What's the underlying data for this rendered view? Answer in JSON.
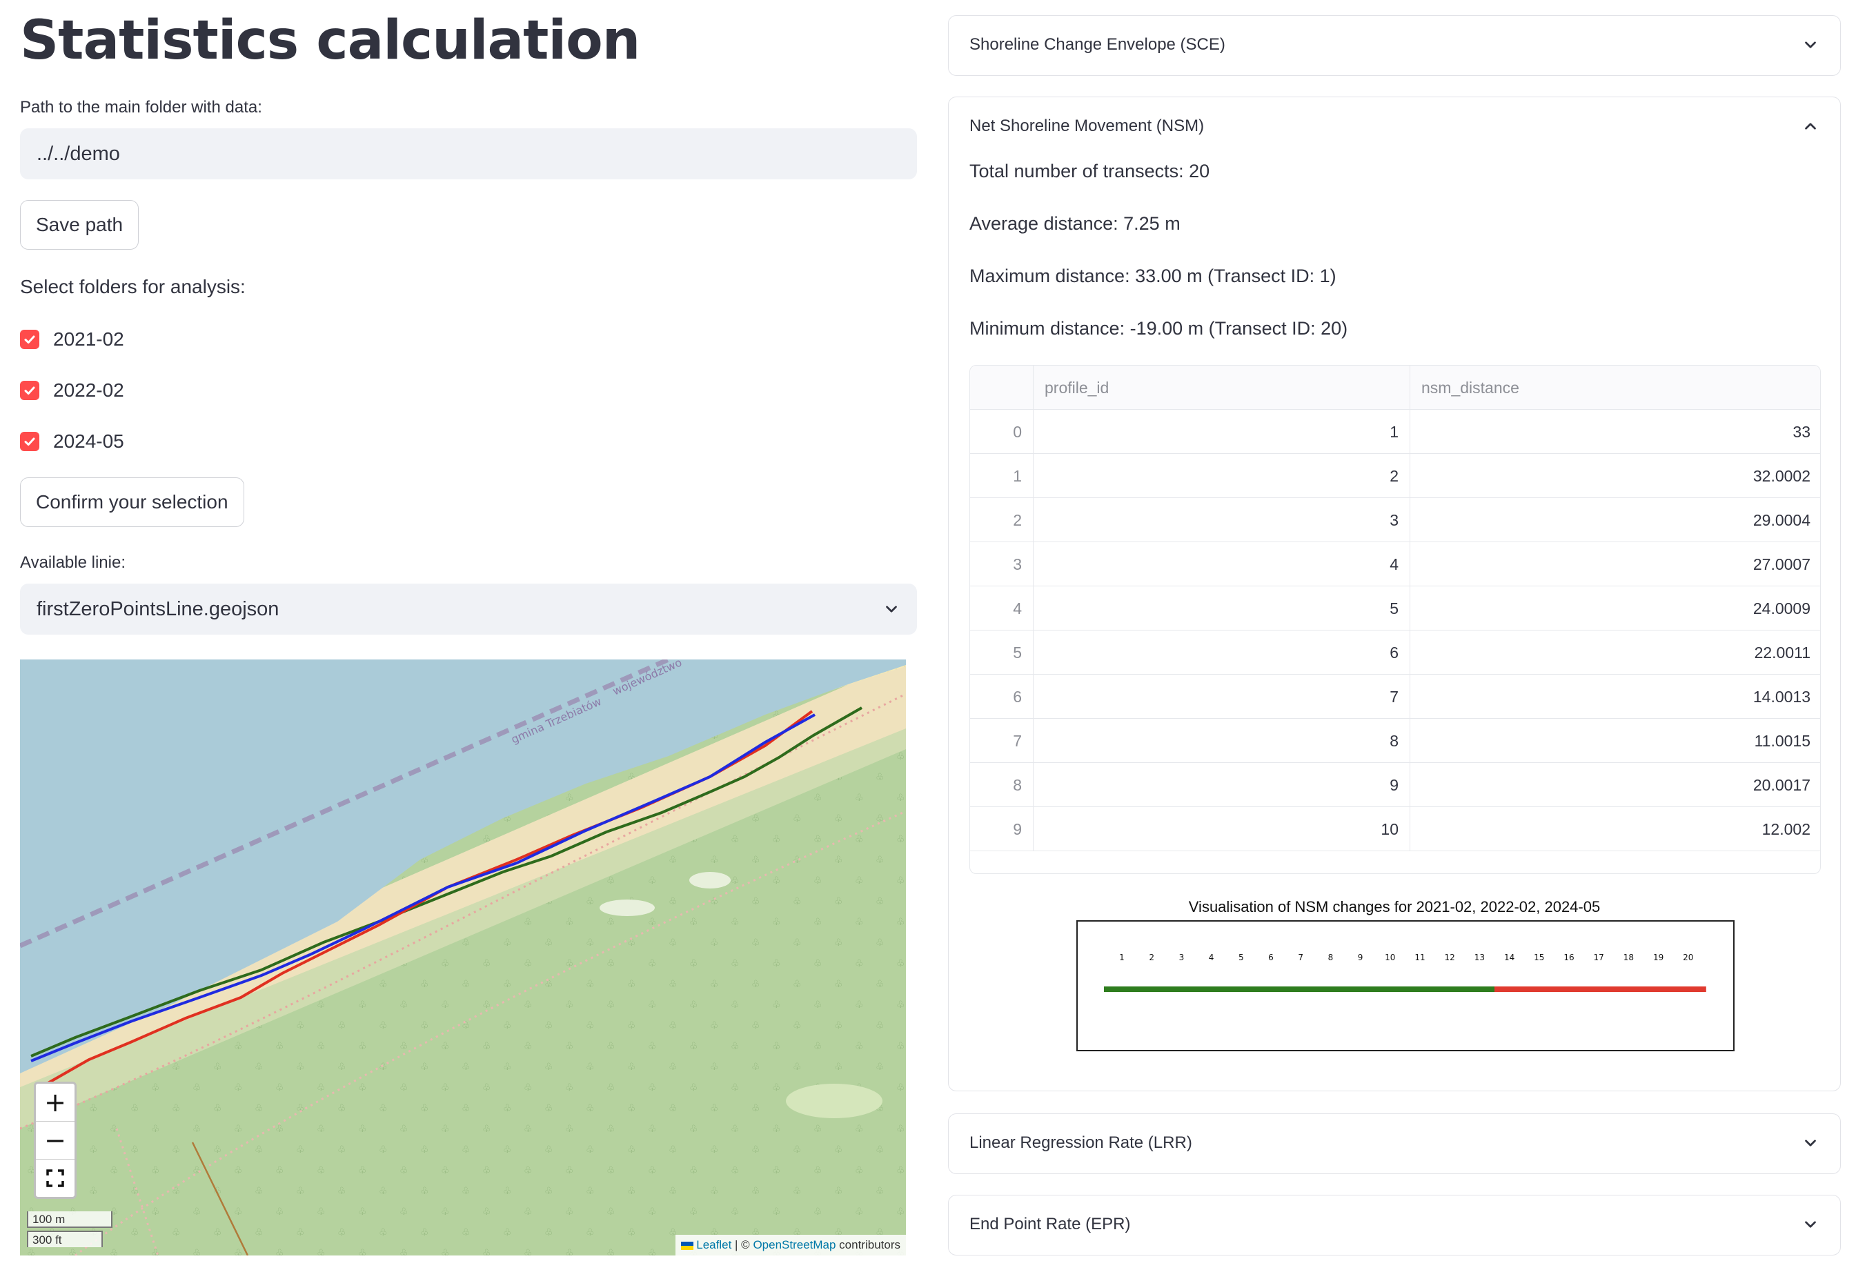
{
  "page": {
    "title": "Statistics calculation",
    "path_label": "Path to the main folder with data:",
    "path_value": "../../demo",
    "save_button": "Save path",
    "select_folders_label": "Select folders for analysis:",
    "folders": [
      {
        "label": "2021-02",
        "checked": true
      },
      {
        "label": "2022-02",
        "checked": true
      },
      {
        "label": "2024-05",
        "checked": true
      }
    ],
    "confirm_button": "Confirm your selection",
    "lines_label": "Available linie:",
    "lines_selected": "firstZeroPointsLine.geojson"
  },
  "map": {
    "labels": [
      "gmina Trzebiatów",
      "województwo"
    ],
    "zoom_in": "+",
    "zoom_out": "−",
    "scale_metric": "100 m",
    "scale_imperial": "300 ft",
    "attribution_leaflet": "Leaflet",
    "attribution_sep": " | © ",
    "attribution_osm": "OpenStreetMap",
    "attribution_tail": " contributors",
    "line_colors": {
      "2021-02": "#2e6b1c",
      "2022-02": "#e03020",
      "2024-05": "#1f2be0"
    },
    "icons": {
      "zoom_in": "plus-icon",
      "zoom_out": "minus-icon",
      "fullscreen": "fullscreen-icon"
    }
  },
  "sections": {
    "sce": {
      "title": "Shoreline Change Envelope (SCE)"
    },
    "nsm": {
      "title": "Net Shoreline Movement (NSM)",
      "total": "Total number of transects: 20",
      "average": "Average distance: 7.25 m",
      "maximum": "Maximum distance: 33.00 m (Transect ID: 1)",
      "minimum": "Minimum distance: -19.00 m (Transect ID: 20)",
      "table": {
        "columns": [
          "",
          "profile_id",
          "nsm_distance"
        ],
        "rows": [
          [
            "0",
            "1",
            "33"
          ],
          [
            "1",
            "2",
            "32.0002"
          ],
          [
            "2",
            "3",
            "29.0004"
          ],
          [
            "3",
            "4",
            "27.0007"
          ],
          [
            "4",
            "5",
            "24.0009"
          ],
          [
            "5",
            "6",
            "22.0011"
          ],
          [
            "6",
            "7",
            "14.0013"
          ],
          [
            "7",
            "8",
            "11.0015"
          ],
          [
            "8",
            "9",
            "20.0017"
          ],
          [
            "9",
            "10",
            "12.002"
          ]
        ]
      }
    },
    "lrr": {
      "title": "Linear Regression Rate (LRR)"
    },
    "epr": {
      "title": "End Point Rate (EPR)"
    }
  },
  "chart_data": {
    "type": "bar",
    "title": "Visualisation of NSM changes for 2021-02, 2022-02, 2024-05",
    "categories": [
      "1",
      "2",
      "3",
      "4",
      "5",
      "6",
      "7",
      "8",
      "9",
      "10",
      "11",
      "12",
      "13",
      "14",
      "15",
      "16",
      "17",
      "18",
      "19",
      "20"
    ],
    "series": [
      {
        "color": "#2e7d1e",
        "range": [
          "1",
          "13"
        ]
      },
      {
        "color": "#e03a2f",
        "range": [
          "14",
          "20"
        ]
      }
    ]
  }
}
